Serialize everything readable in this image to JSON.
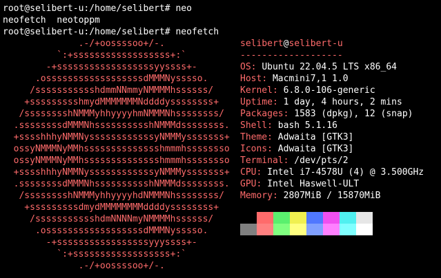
{
  "terminal": {
    "lines": [
      "root@selibert-u:/home/selibert# neo",
      "neofetch  neotoppm",
      "root@selibert-u:/home/selibert# neofetch"
    ]
  },
  "logo": [
    "              .-/+oossssoo+/-.",
    "          `:+ssssssssssssssssss+:`",
    "        -+ssssssssssssssssssyyssss+-",
    "      .ossssssssssssssssssdMMMNysssso.",
    "     /ssssssssssshdmmNNmmyNMMMMhssssss/",
    "    +ssssssssshmydMMMMMMMNddddyssssssss+",
    "   /sssssssshNMMMyhhyyyyhmNMMMNhssssssss/",
    "  .ssssssssdMMMNhsssssssssshNMMMdssssssss.",
    "  +sssshhhyNMMNyssssssssssssyNMMMysssssss+",
    "  ossyNMMMNyMMhsssssssssssssshmmmhssssssso",
    "  ossyNMMMNyMMhsssssssssssssshmmmhssssssso",
    "  +sssshhhyNMMNyssssssssssssyNMMMysssssss+",
    "  .ssssssssdMMMNhsssssssssshNMMMdssssssss.",
    "   /sssssssshNMMMyhhyyyyhdNMMMNhssssssss/",
    "    +sssssssssdmydMMMMMMMMddddyssssssss+",
    "     /ssssssssssshdmNNNNmyNMMMMhssssss/",
    "      .ossssssssssssssssssdMMMNysssso.",
    "        -+sssssssssssssssssyyyssss+-",
    "          `:+ssssssssssssssssss+:`",
    "              .-/+oossssoo+/-."
  ],
  "info": {
    "user": "selibert",
    "at": "@",
    "host": "selibert-u",
    "separator": "-------------------",
    "rows": [
      {
        "key": "OS",
        "value": "Ubuntu 22.04.5 LTS x86_64"
      },
      {
        "key": "Host",
        "value": "Macmini7,1 1.0"
      },
      {
        "key": "Kernel",
        "value": "6.8.0-106-generic"
      },
      {
        "key": "Uptime",
        "value": "1 day, 4 hours, 2 mins"
      },
      {
        "key": "Packages",
        "value": "1583 (dpkg), 12 (snap)"
      },
      {
        "key": "Shell",
        "value": "bash 5.1.16"
      },
      {
        "key": "Theme",
        "value": "Adwaita [GTK3]"
      },
      {
        "key": "Icons",
        "value": "Adwaita [GTK3]"
      },
      {
        "key": "Terminal",
        "value": "/dev/pts/2"
      },
      {
        "key": "CPU",
        "value": "Intel i7-4578U (4) @ 3.500GHz"
      },
      {
        "key": "GPU",
        "value": "Intel Haswell-ULT"
      },
      {
        "key": "Memory",
        "value": "2807MiB / 15870MiB"
      }
    ]
  },
  "palette": {
    "top": [
      "#000000",
      "#ff6b6b",
      "#5af06e",
      "#f0f050",
      "#5078ff",
      "#f050f0",
      "#50f0f0",
      "#e6e6e6"
    ],
    "bottom": [
      "#808080",
      "#ff8080",
      "#80ff80",
      "#ffff80",
      "#80a0ff",
      "#ff80ff",
      "#80ffff",
      "#ffffff"
    ]
  },
  "colors": {
    "accent": "#ff6b6b",
    "background": "#000000",
    "text": "#ffffff"
  }
}
